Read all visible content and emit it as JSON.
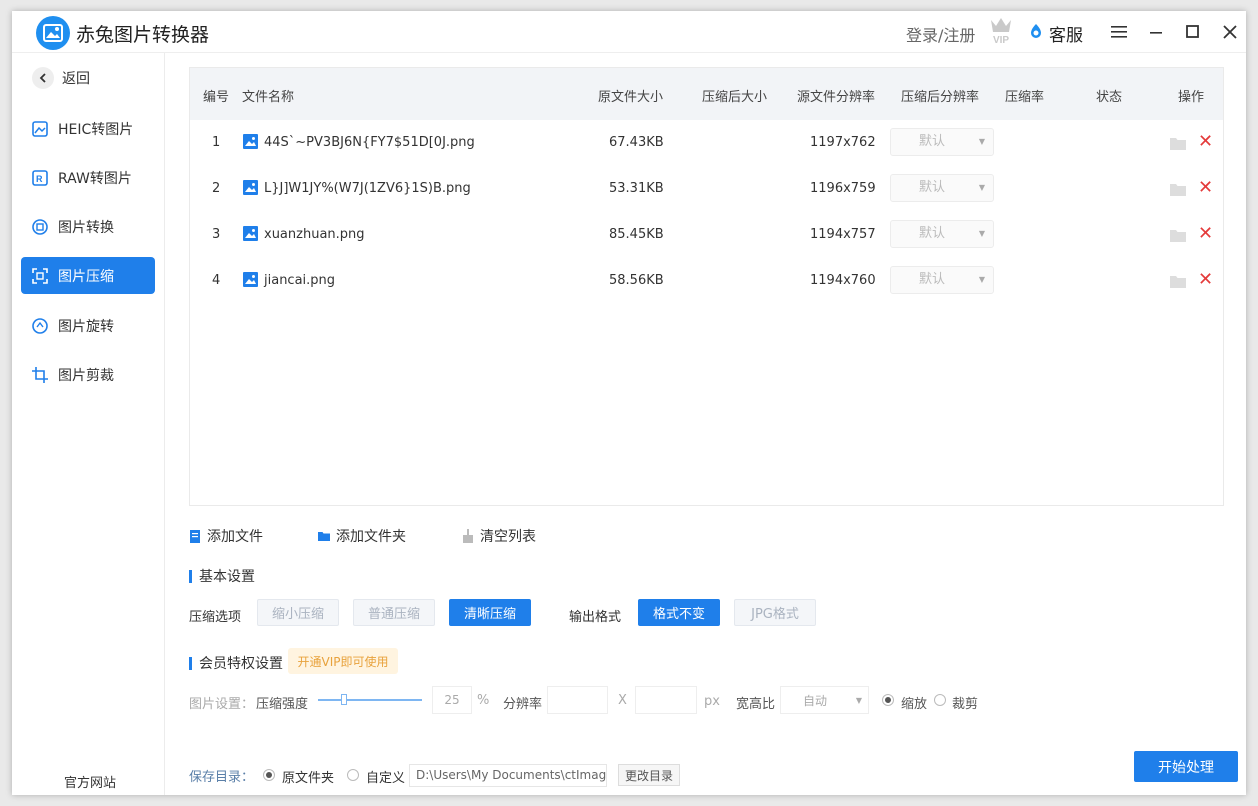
{
  "app": {
    "title": "赤兔图片转换器"
  },
  "titlebar": {
    "login": "登录/注册",
    "vip_badge": "VIP",
    "service": "客服"
  },
  "sidebar": {
    "back": "返回",
    "items": [
      {
        "label": "HEIC转图片",
        "icon": "heic-icon",
        "active": false
      },
      {
        "label": "RAW转图片",
        "icon": "raw-icon",
        "active": false
      },
      {
        "label": "图片转换",
        "icon": "convert-icon",
        "active": false
      },
      {
        "label": "图片压缩",
        "icon": "compress-icon",
        "active": true
      },
      {
        "label": "图片旋转",
        "icon": "rotate-icon",
        "active": false
      },
      {
        "label": "图片剪裁",
        "icon": "crop-icon",
        "active": false
      }
    ],
    "official_site": "官方网站"
  },
  "table": {
    "headers": [
      "编号",
      "文件名称",
      "原文件大小",
      "压缩后大小",
      "源文件分辨率",
      "压缩后分辨率",
      "压缩率",
      "状态",
      "操作"
    ],
    "rows": [
      {
        "no": "1",
        "name": "44S`~PV3BJ6N{FY7$51D[0J.png",
        "size": "67.43KB",
        "compressed": "",
        "resolution": "1197x762",
        "out_res": "默认"
      },
      {
        "no": "2",
        "name": "L}J]W1JY%(W7J(1ZV6}1S)B.png",
        "size": "53.31KB",
        "compressed": "",
        "resolution": "1196x759",
        "out_res": "默认"
      },
      {
        "no": "3",
        "name": "xuanzhuan.png",
        "size": "85.45KB",
        "compressed": "",
        "resolution": "1194x757",
        "out_res": "默认"
      },
      {
        "no": "4",
        "name": "jiancai.png",
        "size": "58.56KB",
        "compressed": "",
        "resolution": "1194x760",
        "out_res": "默认"
      }
    ]
  },
  "actions": {
    "add_file": "添加文件",
    "add_folder": "添加文件夹",
    "clear": "清空列表"
  },
  "basic": {
    "title": "基本设置",
    "compress_label": "压缩选项",
    "compress_options": [
      "缩小压缩",
      "普通压缩",
      "清晰压缩"
    ],
    "compress_selected": "清晰压缩",
    "format_label": "输出格式",
    "format_options": [
      "格式不变",
      "JPG格式"
    ],
    "format_selected": "格式不变"
  },
  "vip": {
    "title": "会员特权设置",
    "tag": "开通VIP即可使用",
    "image_setting": "图片设置：",
    "strength_label": "压缩强度",
    "strength_value": "25",
    "strength_unit": "%",
    "resolution_label": "分辨率",
    "x_sep": "X",
    "px_unit": "px",
    "aspect_label": "宽高比",
    "aspect_value": "自动",
    "scale": "缩放",
    "crop": "裁剪"
  },
  "save": {
    "label": "保存目录：",
    "original": "原文件夹",
    "custom": "自定义",
    "path": "D:\\Users\\My Documents\\ctImageC",
    "change": "更改目录"
  },
  "start_button": "开始处理",
  "colors": {
    "accent": "#1f7fea",
    "delete": "#e43a3a",
    "vip_tag": "#e8a23c"
  }
}
